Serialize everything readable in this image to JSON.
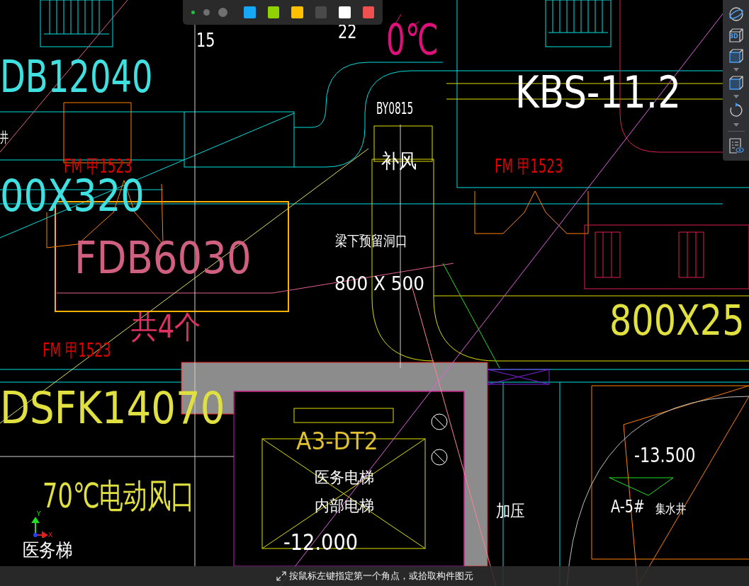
{
  "labels": [
    {
      "text": "15",
      "color": "#ffffff"
    },
    {
      "text": "22",
      "color": "#ffffff"
    },
    {
      "text": "0℃",
      "color": "#e0107a"
    },
    {
      "text": "DB12040",
      "color": "#40e0e0"
    },
    {
      "text": "BY0815",
      "color": "#ffffff"
    },
    {
      "text": "KBS-11.2",
      "color": "#ffffff"
    },
    {
      "text": "井",
      "color": "#ffffff"
    },
    {
      "text": "FM 甲1523",
      "color": "#e00000"
    },
    {
      "text": "补风",
      "color": "#ffffff"
    },
    {
      "text": "FM 甲1523",
      "color": "#e00000"
    },
    {
      "text": "00X320",
      "color": "#40e0e0"
    },
    {
      "text": "梁下预留洞口",
      "color": "#ffffff"
    },
    {
      "text": "FDB6030",
      "color": "#d06080"
    },
    {
      "text": "800 X 500",
      "color": "#ffffff"
    },
    {
      "text": "800X25",
      "color": "#e0e040"
    },
    {
      "text": "共4个",
      "color": "#e03060"
    },
    {
      "text": "FM 甲1523",
      "color": "#e00000"
    },
    {
      "text": "DSFK14070",
      "color": "#e0e040"
    },
    {
      "text": "A3-DT2",
      "color": "#e0c030"
    },
    {
      "text": "-13.500",
      "color": "#ffffff"
    },
    {
      "text": "医务电梯",
      "color": "#ffffff"
    },
    {
      "text": "70℃电动风口",
      "color": "#e0e040"
    },
    {
      "text": "内部电梯",
      "color": "#ffffff"
    },
    {
      "text": "加压",
      "color": "#ffffff"
    },
    {
      "text": "A-5#",
      "color": "#ffffff"
    },
    {
      "text": "集水井",
      "color": "#ffffff"
    },
    {
      "text": "-12.000",
      "color": "#ffffff"
    },
    {
      "text": "医务梯",
      "color": "#ffffff"
    }
  ],
  "axis": {
    "y_label": "Y",
    "x_label": "X"
  },
  "pen_toolbar": {
    "sizes": [
      {
        "selected": true
      },
      {
        "selected": false
      },
      {
        "selected": false
      }
    ],
    "colors": [
      {
        "color": "#17a8f5"
      },
      {
        "color": "#8fd400"
      },
      {
        "color": "#ffc000"
      },
      {
        "color": "#4a4a4a"
      },
      {
        "color": "#ffffff"
      },
      {
        "color": "#f05050"
      }
    ]
  },
  "view_toolbar": [
    {
      "kind": "orbit"
    },
    {
      "kind": "view3d",
      "label": "3D"
    },
    {
      "kind": "cube"
    },
    {
      "kind": "caret"
    },
    {
      "kind": "cube"
    },
    {
      "kind": "caret"
    },
    {
      "kind": "rotate"
    },
    {
      "kind": "caret"
    },
    {
      "kind": "divider"
    },
    {
      "kind": "properties"
    }
  ],
  "status_bar": {
    "prompt": "按鼠标左键指定第一个角点，或拾取构件图元"
  }
}
